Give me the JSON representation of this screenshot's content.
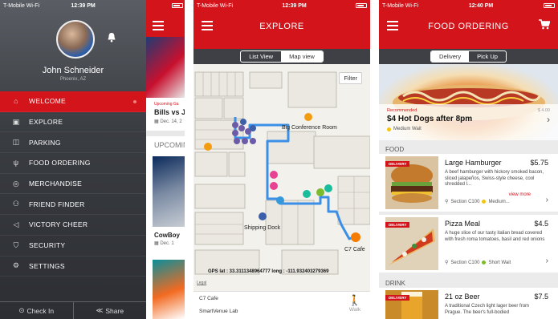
{
  "phone1": {
    "status": {
      "carrier": "T-Mobile Wi-Fi",
      "time": "12:39 PM"
    },
    "user": {
      "name": "John Schneider",
      "location": "Phoenix, AZ"
    },
    "menu": [
      {
        "label": "WELCOME",
        "icon": "home-icon"
      },
      {
        "label": "EXPLORE",
        "icon": "map-icon"
      },
      {
        "label": "PARKING",
        "icon": "parking-icon"
      },
      {
        "label": "FOOD ORDERING",
        "icon": "food-icon"
      },
      {
        "label": "MERCHANDISE",
        "icon": "bag-icon"
      },
      {
        "label": "FRIEND FINDER",
        "icon": "friends-icon"
      },
      {
        "label": "VICTORY CHEER",
        "icon": "megaphone-icon"
      },
      {
        "label": "SECURITY",
        "icon": "shield-icon"
      },
      {
        "label": "SETTINGS",
        "icon": "gear-icon"
      }
    ],
    "bottom": {
      "check_in": "Check In",
      "share": "Share"
    },
    "peek": {
      "upcoming_small": "Upcoming Ga",
      "event_title": "Bills vs Je",
      "event_date": "Dec. 14, 2",
      "upcoming_header": "UPCOMIN",
      "event2_title": "CowBoy",
      "event2_date": "Dec. 1"
    }
  },
  "phone2": {
    "status": {
      "carrier": "T-Mobile Wi-Fi",
      "time": "12:39 PM"
    },
    "title": "EXPLORE",
    "tabs": {
      "list": "List View",
      "map": "Map view"
    },
    "filter": "Filter",
    "labels": {
      "conference": "Big Conference Room",
      "shipping": "Shipping Dock",
      "cafe": "C7 Cafe"
    },
    "gps": "GPS lat : 33.3111348964777     long : -111.932403279369",
    "legal": "Legal",
    "footer": {
      "destination": "C7 Cafe",
      "venue": "SmartVenue Lab",
      "mode": "Walk"
    }
  },
  "phone3": {
    "status": {
      "carrier": "T-Mobile Wi-Fi",
      "time": "12:40 PM"
    },
    "title": "FOOD ORDERING",
    "tabs": {
      "delivery": "Delivery",
      "pickup": "Pick Up"
    },
    "recommended": {
      "label": "Recommended",
      "price": "$ 4.00",
      "title": "$4 Hot Dogs after 8pm",
      "wait": "Medium Wait"
    },
    "sections": {
      "food": "FOOD",
      "drink": "DRINK"
    },
    "items": [
      {
        "badge": "DELIVERY",
        "name": "Large Hamburger",
        "price": "$5.75",
        "desc": "A beef hamburger with hickory smoked bacon, sliced jalapeños, Swiss-style cheese, cool shredded l...",
        "more": "view more",
        "section": "Section C100",
        "wait": "Medium..."
      },
      {
        "badge": "DELIVERY",
        "name": "Pizza Meal",
        "price": "$4.5",
        "desc": "A huge slice of our tasty italian bread covered with fresh roma tomatoes, basil and red onions",
        "section": "Section C100",
        "wait": "Short Wait"
      },
      {
        "badge": "DELIVERY",
        "name": "21 oz Beer",
        "price": "$7.5",
        "desc": "A traditional Czech light lager beer from Prague. The beer's full-bodied"
      }
    ]
  },
  "colors": {
    "accent": "#d3141b",
    "menu_dark": "#3a3d42",
    "seg_bar": "#3e4045",
    "route": "#3b8fe6"
  }
}
